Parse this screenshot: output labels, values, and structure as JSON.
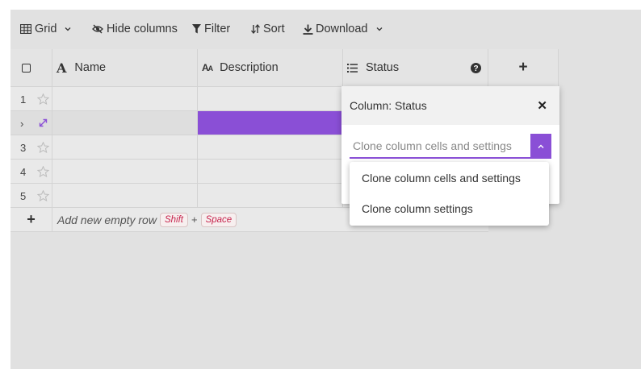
{
  "toolbar": {
    "grid_label": "Grid",
    "hide_columns_label": "Hide columns",
    "filter_label": "Filter",
    "sort_label": "Sort",
    "download_label": "Download"
  },
  "columns": {
    "name": "Name",
    "description": "Description",
    "status": "Status",
    "add": "+"
  },
  "rows": [
    {
      "number": "1"
    },
    {
      "number": "›"
    },
    {
      "number": "3"
    },
    {
      "number": "4"
    },
    {
      "number": "5"
    }
  ],
  "add_row": {
    "plus": "+",
    "label": "Add new empty row",
    "key1": "Shift",
    "joiner": "+",
    "key2": "Space"
  },
  "popup": {
    "title": "Column: Status",
    "close": "✕",
    "select_value": "Clone column cells and settings",
    "options": [
      "Clone column cells and settings",
      "Clone column settings"
    ]
  },
  "colors": {
    "accent": "#8a4fd6",
    "background": "#e1e1e1"
  }
}
